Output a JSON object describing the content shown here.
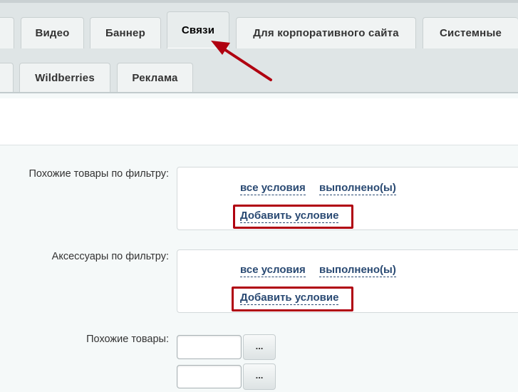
{
  "tabs_row1": [
    "",
    "Видео",
    "Баннер",
    "Связи",
    "Для корпоративного сайта",
    "Системные"
  ],
  "tabs_row2": [
    "",
    "Wildberries",
    "Реклама"
  ],
  "active_tab": "Связи",
  "fields": {
    "similar_by_filter": {
      "label": "Похожие товары по фильтру:",
      "scope": "все условия",
      "state": "выполнено(ы)",
      "add": "Добавить условие"
    },
    "accessories_by_filter": {
      "label": "Аксессуары по фильтру:",
      "scope": "все условия",
      "state": "выполнено(ы)",
      "add": "Добавить условие"
    },
    "similar_products": {
      "label": "Похожие товары:",
      "inputs": [
        "",
        ""
      ],
      "button_label": "..."
    }
  },
  "colors": {
    "highlight": "#b00010",
    "link": "#2a4a73"
  }
}
